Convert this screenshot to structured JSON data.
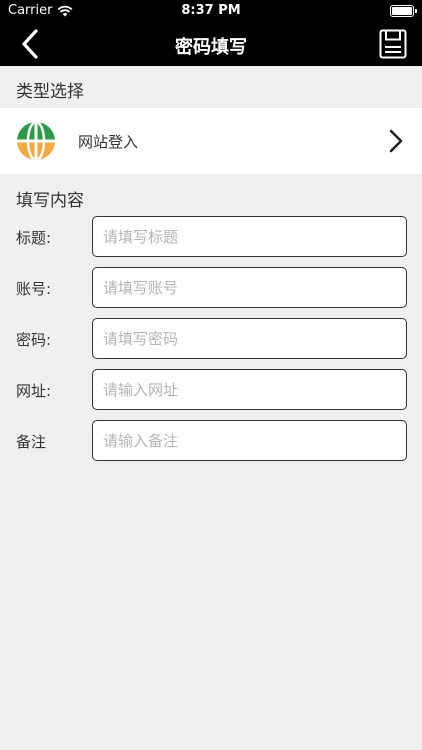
{
  "status_bar": {
    "carrier": "Carrier",
    "time": "8:37 PM"
  },
  "nav": {
    "title": "密码填写",
    "back_icon": "chevron-left-icon",
    "save_icon": "save-icon"
  },
  "type_section": {
    "heading": "类型选择",
    "selected_type": "网站登入",
    "type_icon": "globe-icon"
  },
  "fill_section": {
    "heading": "填写内容",
    "fields": [
      {
        "label": "标题:",
        "placeholder": "请填写标题",
        "value": ""
      },
      {
        "label": "账号:",
        "placeholder": "请填写账号",
        "value": ""
      },
      {
        "label": "密码:",
        "placeholder": "请填写密码",
        "value": ""
      },
      {
        "label": "网址:",
        "placeholder": "请输入网址",
        "value": ""
      },
      {
        "label": "备注",
        "placeholder": "请输入备注",
        "value": ""
      }
    ]
  },
  "colors": {
    "nav_bg": "#000000",
    "page_bg": "#f0f0f0",
    "globe_green": "#2e9b4a",
    "globe_orange": "#f5a840"
  }
}
